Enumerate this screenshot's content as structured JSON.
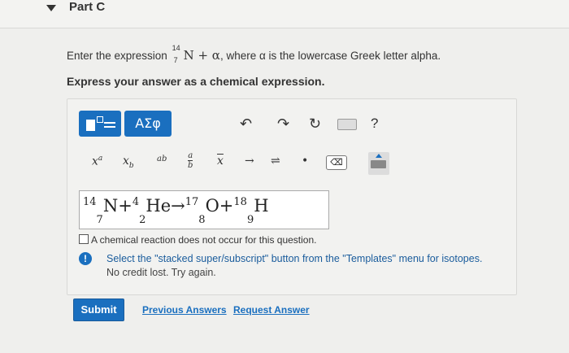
{
  "part": {
    "title": "Part C"
  },
  "question": {
    "prompt_before": "Enter the expression ",
    "isotope_mass": "14",
    "isotope_atomic": "7",
    "expression": "N + α",
    "prompt_after": ", where α is the lowercase Greek letter alpha.",
    "instruction": "Express your answer as a chemical expression."
  },
  "toolbar": {
    "greek_label": "ΑΣφ",
    "help_label": "?",
    "undo_icon": "undo-icon",
    "redo_icon": "redo-icon",
    "reset_icon": "reset-icon",
    "keyboard_icon": "keyboard-icon"
  },
  "templates": {
    "superscript": "xᵃ",
    "subscript": "xb",
    "arrow": "→",
    "equilibrium": "⇌",
    "dot": "•",
    "delete": "⌫"
  },
  "answer": {
    "terms": [
      {
        "sup": "14",
        "sub": "7",
        "sym": "N"
      },
      {
        "op": "+"
      },
      {
        "sup": "4",
        "sub": "2",
        "sym": "He"
      },
      {
        "op": "→"
      },
      {
        "sup": "17",
        "sub": "8",
        "sym": "O"
      },
      {
        "op": "+"
      },
      {
        "sup": "18",
        "sub": "9",
        "sym": "H"
      }
    ]
  },
  "checkbox_label": "A chemical reaction does not occur for this question.",
  "feedback": {
    "line1": "Select the \"stacked super/subscript\" button from the \"Templates\" menu for isotopes.",
    "line2": "No credit lost. Try again."
  },
  "actions": {
    "submit": "Submit",
    "previous_answers": "Previous Answers",
    "request_answer": "Request Answer"
  },
  "colors": {
    "accent": "#1a6fbf"
  }
}
